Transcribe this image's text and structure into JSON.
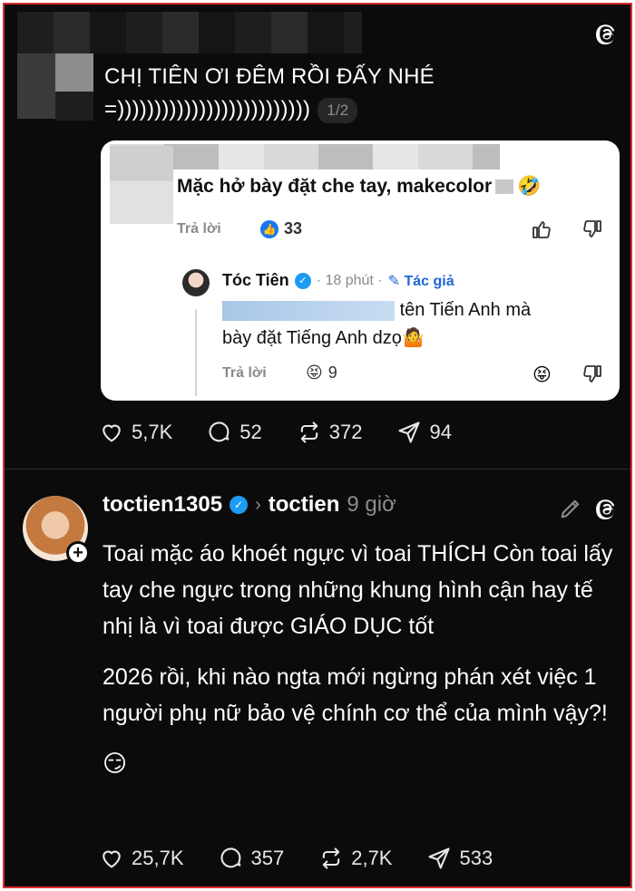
{
  "post1": {
    "text_line1": "CHỊ TIÊN ƠI ĐÊM RỒI ĐẤY NHÉ",
    "text_line2": "=))))))))))))))))))))))))))",
    "page_badge": "1/2",
    "embedded_card": {
      "comment_text": "Mặc hở bày đặt che tay, makecolor",
      "comment_emoji": "🤣",
      "reply_label": "Trả lời",
      "comment_likes": "33",
      "reply": {
        "author": "Tóc Tiên",
        "time": "· 18 phút ·",
        "author_badge": "✎ Tác giả",
        "text_after_blur": "tên Tiến Anh mà",
        "text_line2": "bày đặt Tiếng Anh dzọ",
        "text_emoji": "🤷",
        "reply_label": "Trả lời",
        "reaction_emoji": "😝",
        "reaction_count": "9"
      }
    },
    "actions": {
      "likes": "5,7K",
      "comments": "52",
      "reposts": "372",
      "shares": "94"
    }
  },
  "post2": {
    "username": "toctien1305",
    "chevron": "›",
    "reposted_from": "toctien",
    "time": "9 giờ",
    "paragraph1": "Toai mặc áo khoét ngực vì toai THÍCH Còn toai lấy tay che ngực trong những khung hình cận hay tế nhị là vì toai được GIÁO DỤC tốt",
    "paragraph2": "2026 rồi, khi nào ngta mới ngừng phán xét việc 1 người phụ nữ bảo vệ chính cơ thể của mình vậy?!",
    "emoji": "😏",
    "actions": {
      "likes": "25,7K",
      "comments": "357",
      "reposts": "2,7K",
      "shares": "533"
    }
  },
  "colors": {
    "background": "#0b0b0b",
    "frame_border": "#d8302f",
    "verified": "#1d9bf0",
    "like_blue": "#1877f2"
  },
  "icons": [
    "threads-logo-icon",
    "verified-badge-icon",
    "heart-icon",
    "comment-icon",
    "repost-icon",
    "share-icon",
    "thumbs-up-icon",
    "thumbs-down-icon",
    "pencil-icon",
    "plus-icon"
  ]
}
